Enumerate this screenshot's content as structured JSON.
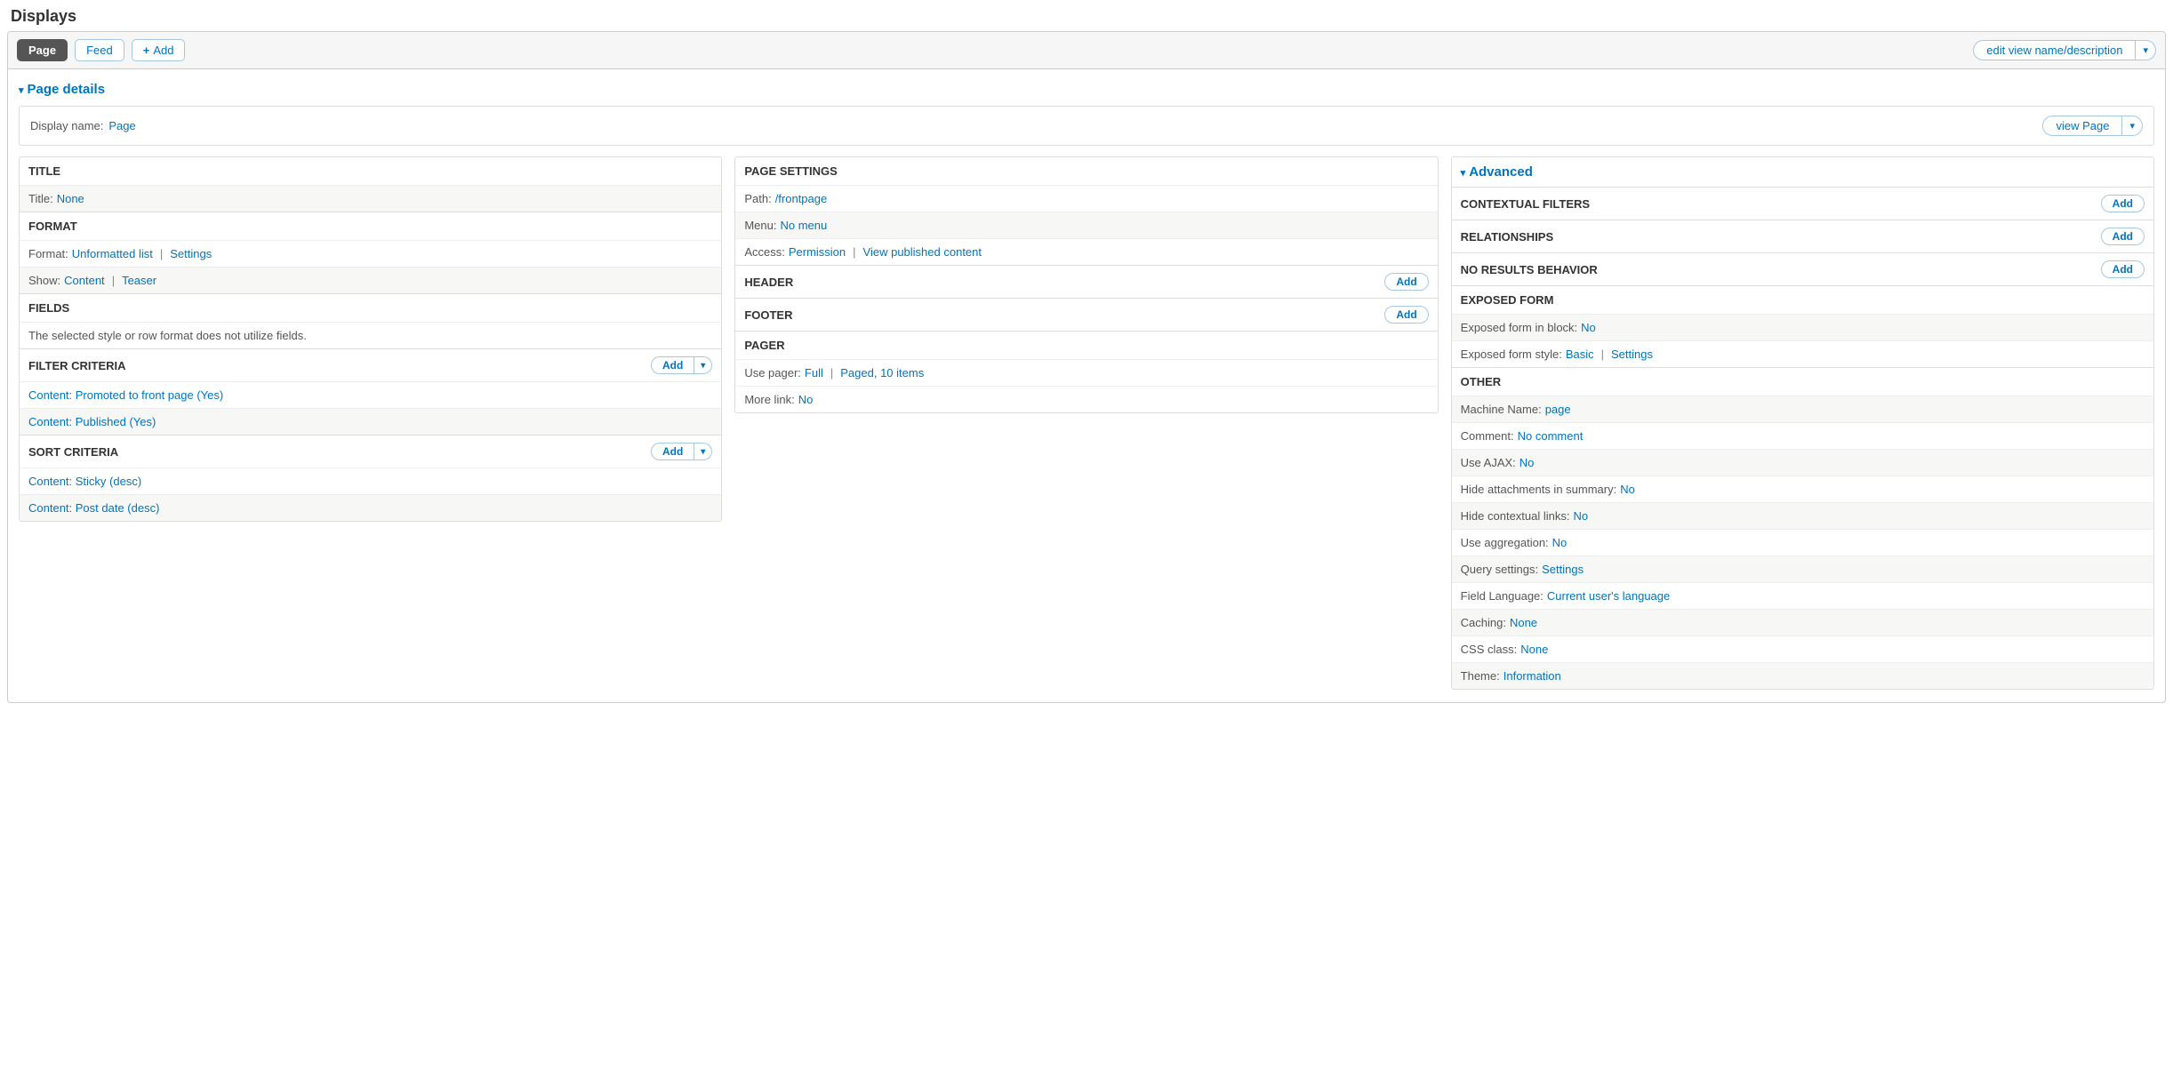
{
  "heading": "Displays",
  "tabs": {
    "page": "Page",
    "feed": "Feed",
    "add": "Add"
  },
  "editViewBtn": "edit view name/description",
  "pageDetails": {
    "summary": "Page details",
    "displayNameLabel": "Display name:",
    "displayNameValue": "Page",
    "viewPageBtn": "view Page"
  },
  "col1": {
    "title": {
      "head": "TITLE",
      "label": "Title:",
      "value": "None"
    },
    "format": {
      "head": "FORMAT",
      "formatLabel": "Format:",
      "formatValue": "Unformatted list",
      "settings": "Settings",
      "showLabel": "Show:",
      "showValue": "Content",
      "teaser": "Teaser"
    },
    "fields": {
      "head": "FIELDS",
      "note": "The selected style or row format does not utilize fields."
    },
    "filter": {
      "head": "FILTER CRITERIA",
      "add": "Add",
      "items": [
        "Content: Promoted to front page (Yes)",
        "Content: Published (Yes)"
      ]
    },
    "sort": {
      "head": "SORT CRITERIA",
      "add": "Add",
      "items": [
        "Content: Sticky (desc)",
        "Content: Post date (desc)"
      ]
    }
  },
  "col2": {
    "ps": {
      "head": "PAGE SETTINGS",
      "pathLabel": "Path:",
      "pathValue": "/frontpage",
      "menuLabel": "Menu:",
      "menuValue": "No menu",
      "accessLabel": "Access:",
      "accessValue": "Permission",
      "accessExtra": "View published content"
    },
    "header": {
      "head": "HEADER",
      "add": "Add"
    },
    "footer": {
      "head": "FOOTER",
      "add": "Add"
    },
    "pager": {
      "head": "PAGER",
      "useLabel": "Use pager:",
      "useValue": "Full",
      "useExtra": "Paged, 10 items",
      "moreLabel": "More link:",
      "moreValue": "No"
    }
  },
  "col3": {
    "advanced": "Advanced",
    "contextual": {
      "head": "CONTEXTUAL FILTERS",
      "add": "Add"
    },
    "relationships": {
      "head": "RELATIONSHIPS",
      "add": "Add"
    },
    "noresults": {
      "head": "NO RESULTS BEHAVIOR",
      "add": "Add"
    },
    "exposed": {
      "head": "EXPOSED FORM",
      "blockLabel": "Exposed form in block:",
      "blockValue": "No",
      "styleLabel": "Exposed form style:",
      "styleValue": "Basic",
      "settings": "Settings"
    },
    "other": {
      "head": "OTHER",
      "rows": [
        {
          "k": "Machine Name:",
          "v": "page"
        },
        {
          "k": "Comment:",
          "v": "No comment"
        },
        {
          "k": "Use AJAX:",
          "v": "No"
        },
        {
          "k": "Hide attachments in summary:",
          "v": "No"
        },
        {
          "k": "Hide contextual links:",
          "v": "No"
        },
        {
          "k": "Use aggregation:",
          "v": "No"
        },
        {
          "k": "Query settings:",
          "v": "Settings"
        },
        {
          "k": "Field Language:",
          "v": "Current user's language"
        },
        {
          "k": "Caching:",
          "v": "None"
        },
        {
          "k": "CSS class:",
          "v": "None"
        },
        {
          "k": "Theme:",
          "v": "Information"
        }
      ]
    }
  }
}
